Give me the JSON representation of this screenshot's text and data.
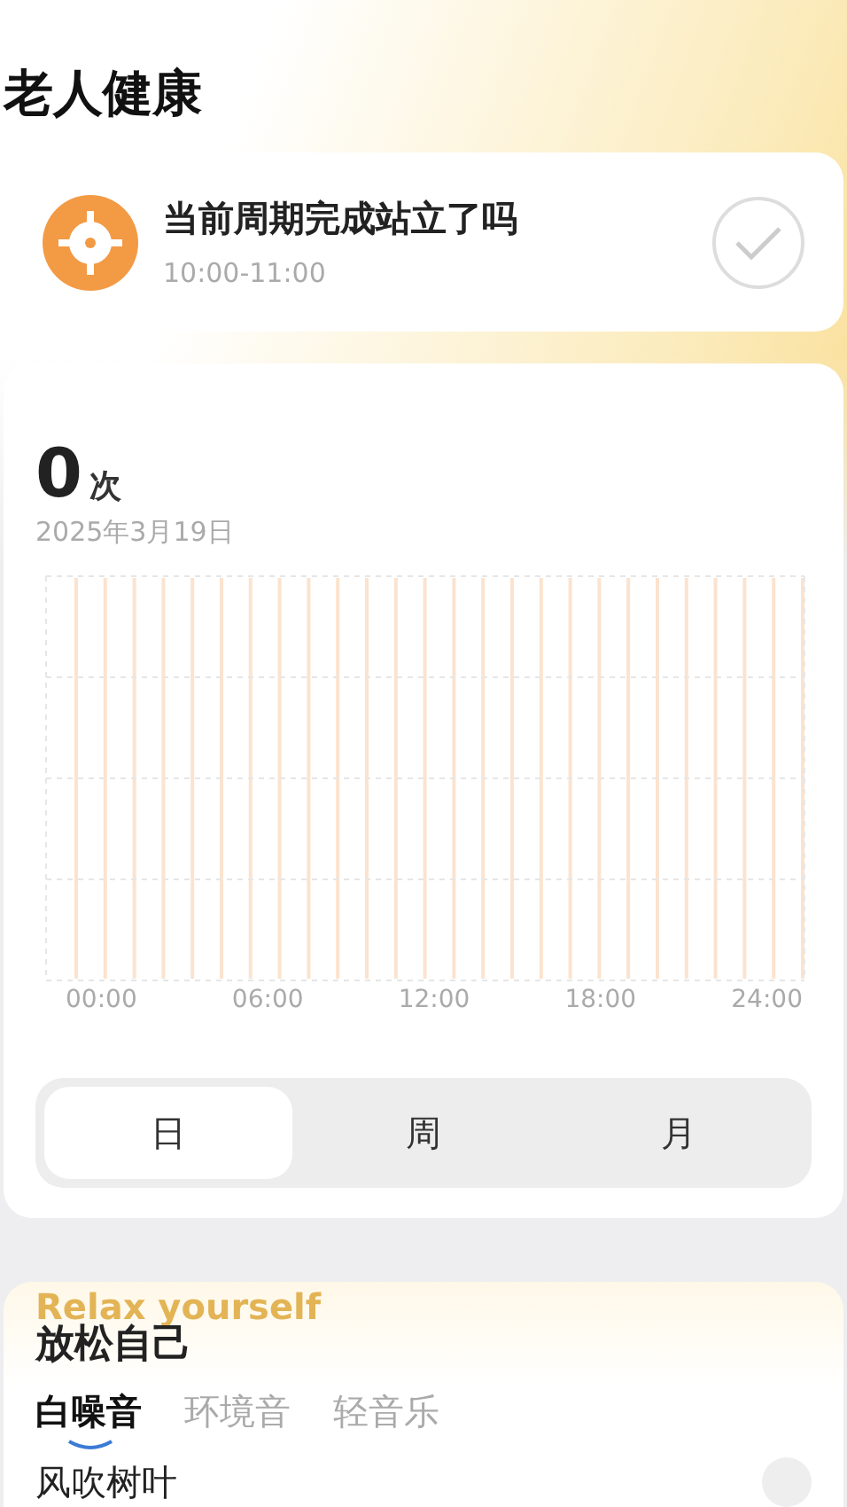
{
  "header": {
    "title": "老人健康"
  },
  "reminder": {
    "title": "当前周期完成站立了吗",
    "time": "10:00-11:00",
    "done": false
  },
  "stats": {
    "count": "0",
    "unit": "次",
    "date": "2025年3月19日",
    "x_labels": [
      "00:00",
      "06:00",
      "12:00",
      "18:00",
      "24:00"
    ],
    "periods": [
      {
        "label": "日",
        "selected": true
      },
      {
        "label": "周",
        "selected": false
      },
      {
        "label": "月",
        "selected": false
      }
    ]
  },
  "relax": {
    "backdrop_text": "Relax yourself",
    "title": "放松自己",
    "tabs": [
      {
        "label": "白噪音",
        "selected": true
      },
      {
        "label": "环境音",
        "selected": false
      },
      {
        "label": "轻音乐",
        "selected": false
      }
    ],
    "items": [
      {
        "name": "风吹树叶"
      }
    ]
  }
}
